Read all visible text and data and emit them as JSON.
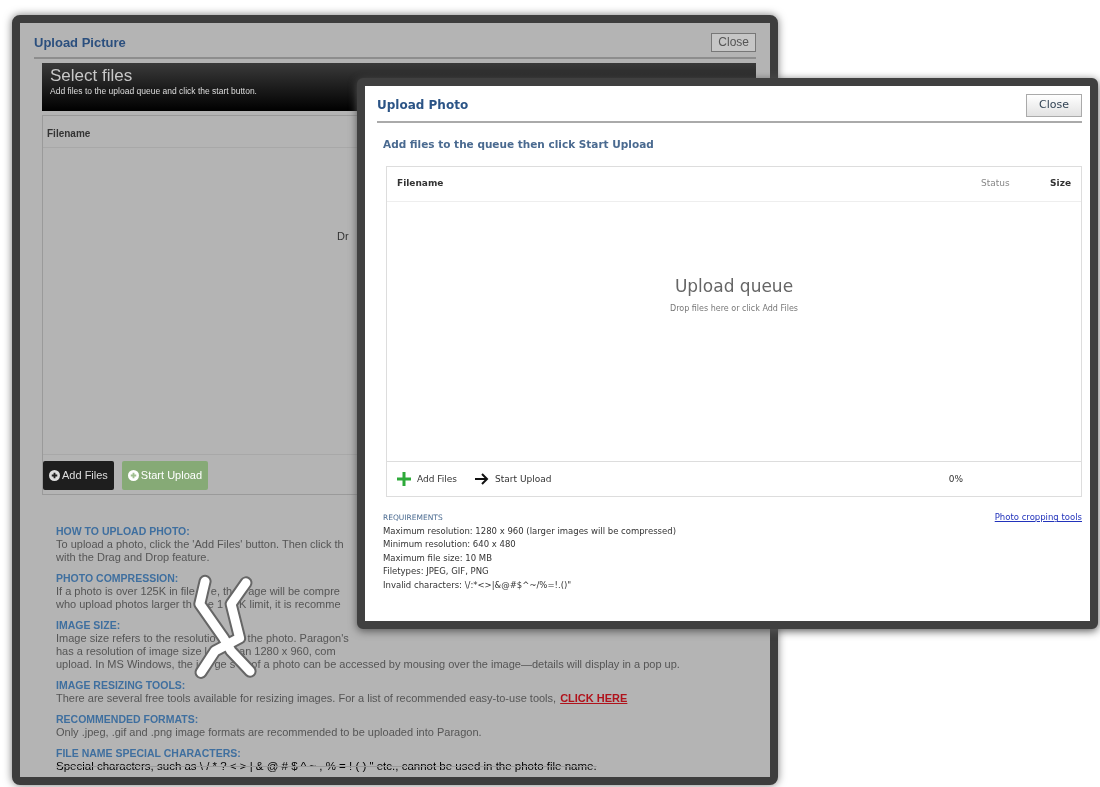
{
  "back_dialog": {
    "title": "Upload Picture",
    "close_button": "Close",
    "header": {
      "title": "Select files",
      "subtitle": "Add files to the upload queue and click the start button."
    },
    "table": {
      "columns": [
        "Filename"
      ],
      "drop_hint": "Dr"
    },
    "buttons": [
      {
        "label": "Add Files",
        "disabled": false
      },
      {
        "label": "Start Upload",
        "disabled": true
      }
    ],
    "help_sections": [
      {
        "heading": "HOW TO UPLOAD PHOTO:",
        "lines": [
          "To upload a photo, click the 'Add Files' button. Then click th",
          "with the Drag and Drop feature."
        ],
        "struck": false
      },
      {
        "heading": "PHOTO COMPRESSION:",
        "lines": [
          [
            "If a photo is over 125K in file",
            "e, th",
            "age will be compre"
          ],
          [
            "who upload photos larger th",
            "e 1",
            "K limit, it is recomme"
          ]
        ],
        "struck": false
      },
      {
        "heading": "IMAGE SIZE:",
        "lines": [
          [
            "Image size refers to the resolutio",
            "the photo. Paragon's"
          ],
          [
            "has a resolution of image size l",
            "an 1280 x 960, com"
          ],
          [
            "upload. In MS Windows, the i",
            "ge s",
            "of a photo can be accessed by mousing over the image—details will display in a pop up."
          ]
        ],
        "struck": false
      },
      {
        "heading": "IMAGE RESIZING TOOLS:",
        "lines": [
          "There are several free tools available for resizing images. For a list of recommended easy-to-use tools,"
        ],
        "link": "CLICK HERE",
        "struck": false
      },
      {
        "heading": "RECOMMENDED FORMATS:",
        "lines": [
          "Only .jpeg, .gif and .png image formats are recommended to be uploaded into Paragon."
        ],
        "struck": false
      },
      {
        "heading": "FILE NAME SPECIAL CHARACTERS:",
        "lines": [
          "Special characters, such as \\ / * ? < > | & @ # $ ^ ~ , % = ! ( ) \" etc., cannot be used in the photo file name."
        ],
        "struck": true
      }
    ]
  },
  "front_dialog": {
    "title": "Upload Photo",
    "close_button": "Close",
    "instruction": "Add files to the queue then click Start Upload",
    "table": {
      "columns": [
        {
          "label": "Filename",
          "muted": false
        },
        {
          "label": "Status",
          "muted": true
        },
        {
          "label": "Size",
          "muted": false
        }
      ],
      "queue_title": "Upload queue",
      "queue_hint": "Drop files here or click Add Files",
      "actions": [
        {
          "label": "Add Files",
          "kind": "add"
        },
        {
          "label": "Start Upload",
          "kind": "start"
        }
      ],
      "progress": "0%"
    },
    "requirements": {
      "heading": "REQUIREMENTS",
      "link": "Photo cropping tools",
      "lines": [
        "Maximum resolution: 1280 x 960 (larger images will be compressed)",
        "Minimum resolution: 640 x 480",
        "Maximum file size: 10 MB",
        "Filetypes: JPEG, GIF, PNG",
        "Invalid characters: \\/:*<>|&@#$^~/%=!.()\""
      ]
    }
  }
}
